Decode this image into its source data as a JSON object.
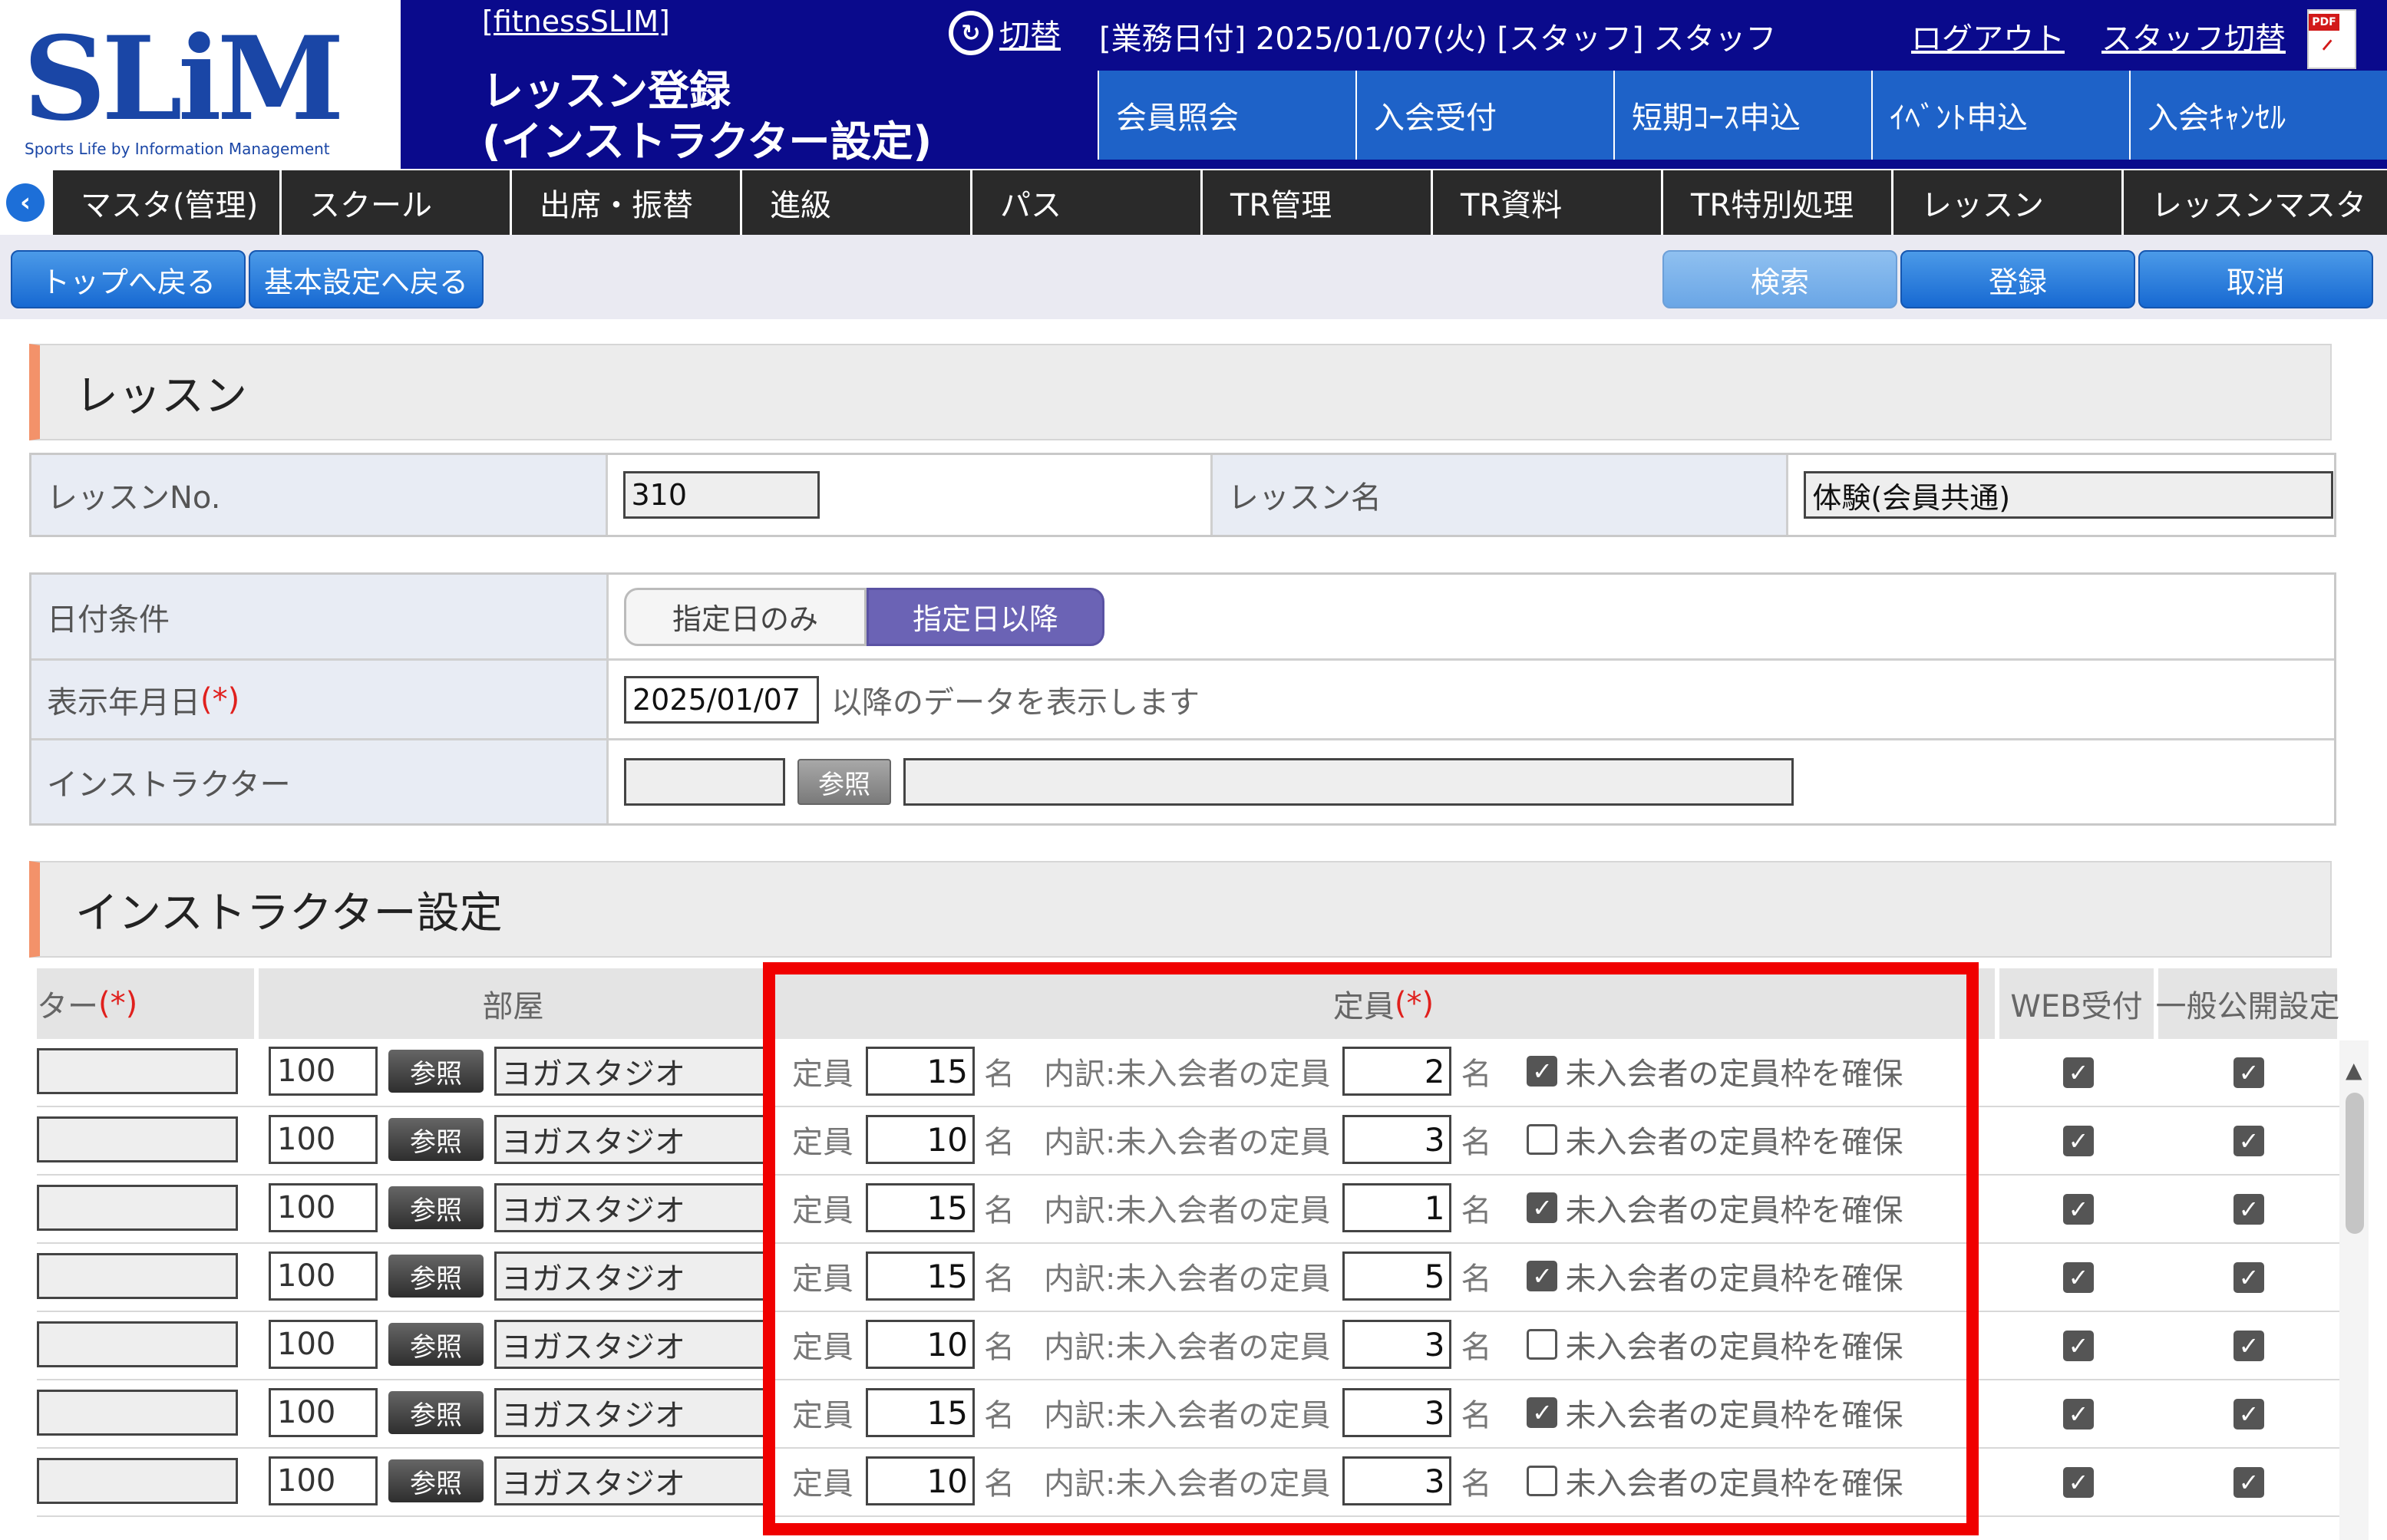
{
  "header": {
    "logo_text": "SLiM",
    "logo_subtitle": "Sports Life by Information Management",
    "system_name": "[fitnessSLIM]",
    "page_title_line1": "レッスン登録",
    "page_title_line2": "(インストラクター設定)",
    "switch_label": "切替",
    "business_info": "[業務日付] 2025/01/07(火) [スタッフ] スタッフ",
    "logout_label": "ログアウト",
    "staff_switch_label": "スタッフ切替",
    "pdf_icon": "pdf-file-icon",
    "brand_color": "#0a0a8c"
  },
  "top_nav": [
    "会員照会",
    "入会受付",
    "短期ｺｰｽ申込",
    "ｲﾍﾞﾝﾄ申込",
    "入会ｷｬﾝｾﾙ"
  ],
  "main_nav": [
    "マスタ(管理)",
    "スクール",
    "出席・振替",
    "進級",
    "パス",
    "TR管理",
    "TR資料",
    "TR特別処理",
    "レッスン",
    "レッスンマスタ"
  ],
  "toolbar": {
    "back_top_label": "トップへ戻る",
    "back_basic_label": "基本設定へ戻る",
    "search_label": "検索",
    "register_label": "登録",
    "cancel_label": "取消"
  },
  "lesson_section": {
    "title": "レッスン",
    "lesson_no_label": "レッスンNo.",
    "lesson_no_value": "310",
    "lesson_name_label": "レッスン名",
    "lesson_name_value": "体験(会員共通)"
  },
  "filter": {
    "date_condition_label": "日付条件",
    "date_option_only": "指定日のみ",
    "date_option_after": "指定日以降",
    "display_date_label": "表示年月日",
    "required_mark": "(*)",
    "display_date_value": "2025/01/07",
    "display_date_suffix": "以降のデータを表示します",
    "instructor_label": "インストラクター",
    "instructor_ref_label": "参照",
    "instructor_code_value": "",
    "instructor_name_value": ""
  },
  "instructor_section": {
    "title": "インストラクター設定",
    "columns": {
      "instructor": "ター",
      "room": "部屋",
      "capacity": "定員",
      "web": "WEB受付",
      "public": "一般公開設定",
      "required_mark": "(*)"
    },
    "labels": {
      "capacity": "定員",
      "unit": "名",
      "breakdown": "内訳:未入会者の定員",
      "reserve": "未入会者の定員枠を確保",
      "ref": "参照"
    },
    "rows": [
      {
        "room_code": "100",
        "room_name": "ヨガスタジオ",
        "capacity": "15",
        "non_member_capacity": "2",
        "reserve": true,
        "web": true,
        "public": true
      },
      {
        "room_code": "100",
        "room_name": "ヨガスタジオ",
        "capacity": "10",
        "non_member_capacity": "3",
        "reserve": false,
        "web": true,
        "public": true
      },
      {
        "room_code": "100",
        "room_name": "ヨガスタジオ",
        "capacity": "15",
        "non_member_capacity": "1",
        "reserve": true,
        "web": true,
        "public": true
      },
      {
        "room_code": "100",
        "room_name": "ヨガスタジオ",
        "capacity": "15",
        "non_member_capacity": "5",
        "reserve": true,
        "web": true,
        "public": true
      },
      {
        "room_code": "100",
        "room_name": "ヨガスタジオ",
        "capacity": "10",
        "non_member_capacity": "3",
        "reserve": false,
        "web": true,
        "public": true
      },
      {
        "room_code": "100",
        "room_name": "ヨガスタジオ",
        "capacity": "15",
        "non_member_capacity": "3",
        "reserve": true,
        "web": true,
        "public": true
      },
      {
        "room_code": "100",
        "room_name": "ヨガスタジオ",
        "capacity": "10",
        "non_member_capacity": "3",
        "reserve": false,
        "web": true,
        "public": true
      }
    ]
  },
  "highlight_color": "#f00000"
}
